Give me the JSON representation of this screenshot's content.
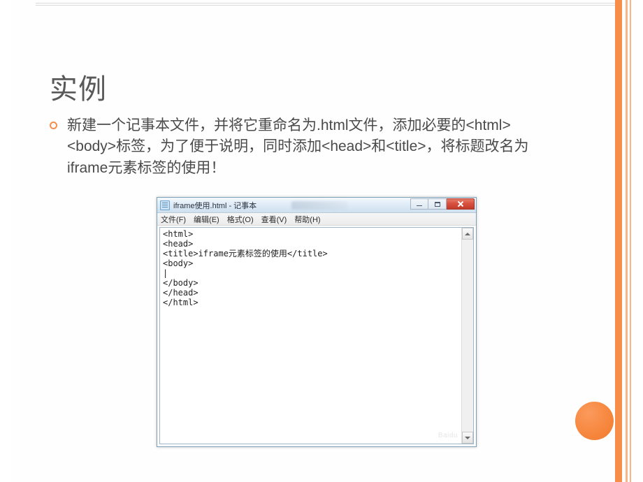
{
  "slide": {
    "title": "实例",
    "bullet_text": "新建一个记事本文件，并将它重命名为.html文件，添加必要的<html><body>标签，为了便于说明，同时添加<head>和<title>，将标题改名为iframe元素标签的使用！"
  },
  "notepad": {
    "title": "iframe使用.html - 记事本",
    "menus": [
      "文件(F)",
      "编辑(E)",
      "格式(O)",
      "查看(V)",
      "帮助(H)"
    ],
    "content": "<html>\n<head>\n<title>iframe元素标签的使用</title>\n<body>\n|\n</body>\n</head>\n</html>",
    "watermark": "Baidu"
  }
}
